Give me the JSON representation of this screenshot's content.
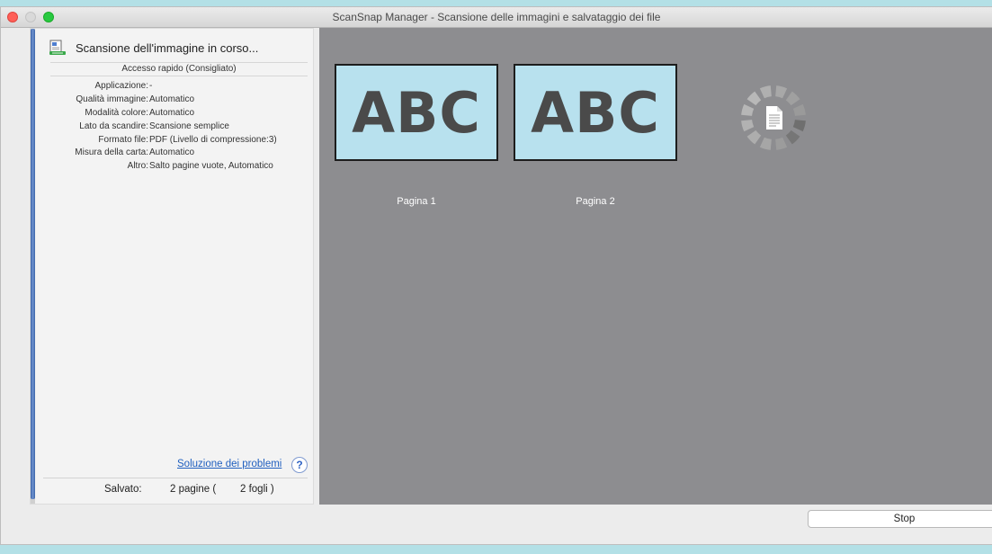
{
  "window": {
    "title": "ScanSnap Manager - Scansione delle immagini e salvataggio dei file"
  },
  "status": {
    "text": "Scansione dell'immagine in corso...",
    "progress": 0.99
  },
  "profile": {
    "name": "Accesso rapido (Consigliato)"
  },
  "settings": [
    {
      "label": "Applicazione:",
      "value": "-"
    },
    {
      "label": "Qualità immagine:",
      "value": "Automatico"
    },
    {
      "label": "Modalità colore:",
      "value": "Automatico"
    },
    {
      "label": "Lato da scandire:",
      "value": "Scansione semplice"
    },
    {
      "label": "Formato file:",
      "value": "PDF (Livello di compressione:3)"
    },
    {
      "label": "Misura della carta:",
      "value": "Automatico"
    },
    {
      "label": "Altro:",
      "value": "Salto pagine vuote, Automatico"
    }
  ],
  "help": {
    "link_label": "Soluzione dei problemi",
    "button_label": "?"
  },
  "footer": {
    "saved_label": "Salvato:",
    "pages": "2 pagine   (",
    "sheets": "2 fogli )"
  },
  "pages": [
    {
      "image_text": "ABC",
      "label": "Pagina 1"
    },
    {
      "image_text": "ABC",
      "label": "Pagina 2"
    }
  ],
  "buttons": {
    "stop": "Stop"
  },
  "colors": {
    "background": "#b3e0e6",
    "preview_bg": "#8d8d90",
    "thumb_bg": "#b8e1ee",
    "progress": "#3c64a8",
    "link": "#1f5fbf"
  },
  "icons": {
    "status": "scan-document-icon",
    "busy": "loading-spinner-icon",
    "help": "question-mark-icon"
  }
}
